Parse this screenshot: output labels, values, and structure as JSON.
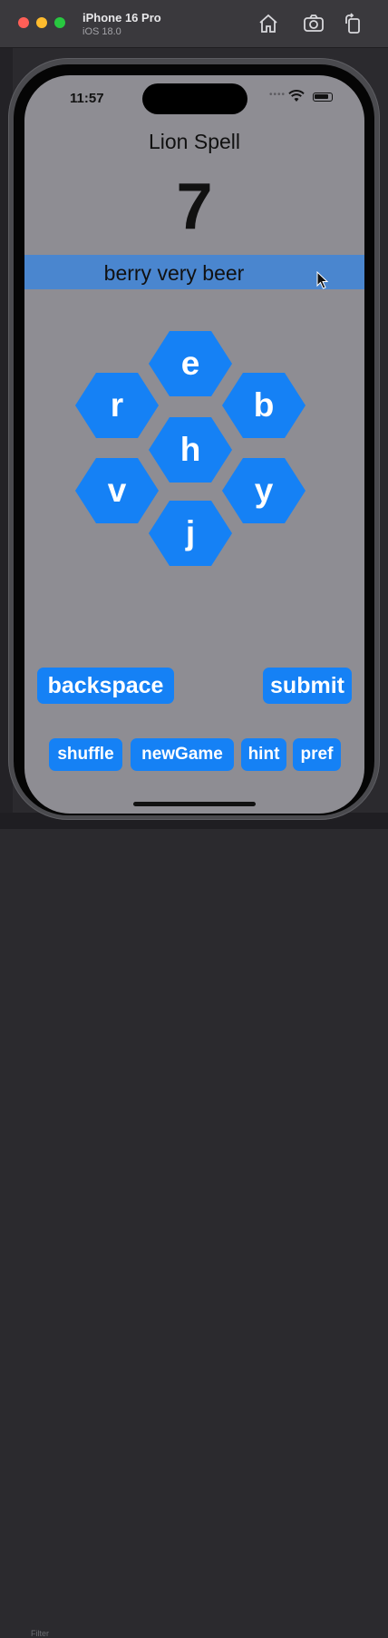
{
  "simulator": {
    "device_name": "iPhone 16 Pro",
    "os_version": "iOS 18.0",
    "toolbar_icons": [
      "home-icon",
      "screenshot-icon",
      "rotate-icon"
    ]
  },
  "ide": {
    "filter_label": "Filter"
  },
  "status_bar": {
    "time": "11:57",
    "signal_dots": "••••"
  },
  "app": {
    "title": "Lion Spell",
    "score": "7",
    "found_words": "berry very beer",
    "letters": {
      "top": "e",
      "upper_left": "r",
      "upper_right": "b",
      "center": "h",
      "lower_left": "v",
      "lower_right": "y",
      "bottom": "j"
    },
    "buttons": {
      "backspace": "backspace",
      "submit": "submit",
      "shuffle": "shuffle",
      "new_game": "newGame",
      "hint": "hint",
      "pref": "pref"
    }
  },
  "colors": {
    "accent": "#1581f5",
    "found_bar": "#4a86cf",
    "screen_background": "#8e8d93"
  }
}
